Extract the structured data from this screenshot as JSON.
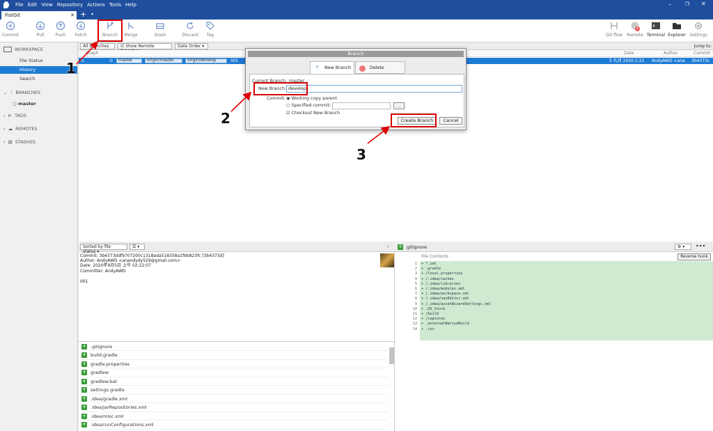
{
  "app": {
    "menu": [
      "File",
      "Edit",
      "View",
      "Repository",
      "Actions",
      "Tools",
      "Help"
    ],
    "tab": "FistGit"
  },
  "toolbar": {
    "left": [
      "Commit",
      "Pull",
      "Push",
      "Fetch",
      "Branch",
      "Merge",
      "Stash",
      "Discard",
      "Tag"
    ],
    "right": [
      "Git-flow",
      "Remote",
      "Terminal",
      "Explorer",
      "Settings"
    ],
    "remote_badge": "1"
  },
  "sidebar": {
    "workspace": "WORKSPACE",
    "items": [
      "File Status",
      "History",
      "Search"
    ],
    "branches": "BRANCHES",
    "branch_items": [
      "master"
    ],
    "tags": "TAGS",
    "remotes": "REMOTES",
    "stashes": "STASHES"
  },
  "history": {
    "filter_branches": "All Branches",
    "show_remote": "Show Remote Branches",
    "order": "Date Order",
    "jump": "Jump to:",
    "col_graph": "Graph",
    "col_date": "Date",
    "col_author": "Author",
    "col_commit": "Commit",
    "row": {
      "tags": [
        "master",
        "origin/master",
        "origin/develop"
      ],
      "message": "001",
      "date": "5 九月 2020 2:22",
      "author": "AndyAWD <ana",
      "commit": "3b4373c"
    }
  },
  "dialog": {
    "title": "Branch",
    "tab_new": "New Branch",
    "tab_delete": "Delete Branches",
    "current_label": "Current Branch:",
    "current_value": "master",
    "new_label": "New Branch:",
    "new_value": "develop",
    "commit_label": "Commit:",
    "opt1": "Working copy parent",
    "opt2": "Specified commit:",
    "browse": "...",
    "checkout": "Checkout New Branch",
    "create": "Create Branch",
    "cancel": "Cancel"
  },
  "annotations": [
    "1",
    "2",
    "3"
  ],
  "details": {
    "sort": "Sorted by file status",
    "commit_line": "Commit: 3b4373ddf9707200c1318ada518358a1fbb823fc [3b4373d]",
    "author_line": "Author: AndyAWD <anandydy529@gmail.com>",
    "date_line": "Date: 2020年9月5日 上午 02:22:07",
    "committer_line": "Committer: AndyAWD",
    "message": "001"
  },
  "files": [
    ".gitignore",
    "build.gradle",
    "gradle.properties",
    "gradlew",
    "gradlew.bat",
    "settings.gradle",
    ".idea/gradle.xml",
    ".idea/jarRepositories.xml",
    ".idea/misc.xml",
    ".idea/runConfigurations.xml"
  ],
  "diff": {
    "file": ".gitignore",
    "header": "File Contents",
    "reverse": "Reverse hunk",
    "lines": [
      "+ *.iml",
      "+ .gradle",
      "+ /local.properties",
      "+ /.idea/caches",
      "+ /.idea/libraries",
      "+ /.idea/modules.xml",
      "+ /.idea/workspace.xml",
      "+ /.idea/navEditor.xml",
      "+ /.idea/assetWizardSettings.xml",
      "+ .DS_Store",
      "+ /build",
      "+ /captures",
      "+ .externalNativeBuild",
      "+ .cxx"
    ]
  }
}
